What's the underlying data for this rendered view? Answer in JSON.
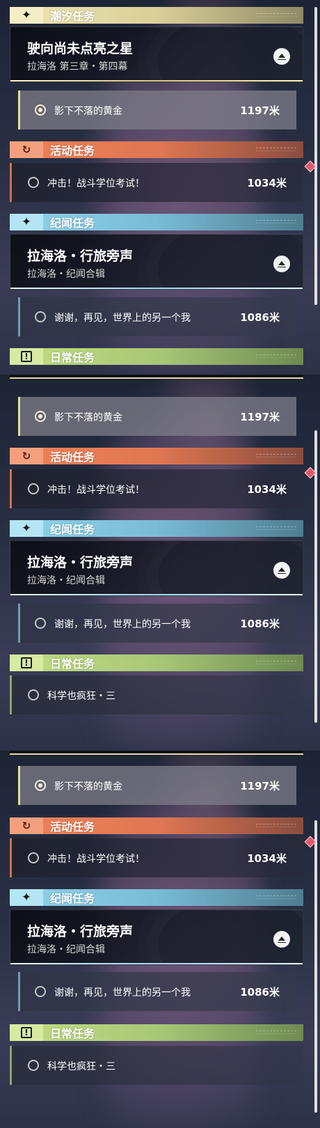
{
  "categories": {
    "trend": "潮汐任务",
    "event": "活动任务",
    "lore": "纪闻任务",
    "daily": "日常任务"
  },
  "main_quest": {
    "title": "驶向尚未点亮之星",
    "subtitle": "拉海洛 第三章・第四幕"
  },
  "tracked_quest": {
    "name": "影下不落的黄金",
    "distance": "1197米"
  },
  "event_quest": {
    "name": "冲击！战斗学位考试！",
    "distance": "1034米"
  },
  "lore_quest": {
    "title": "拉海洛・行旅旁声",
    "subtitle": "拉海洛・纪闻合辑"
  },
  "lore_sub": {
    "name": "谢谢，再见，世界上的另一个我",
    "distance": "1086米"
  },
  "daily_quest": {
    "name": "科学也疯狂・三"
  },
  "icons": {
    "trend": "four-point-star-icon",
    "event": "event-refresh-icon",
    "lore": "four-point-star-icon",
    "daily": "exclamation-box-icon"
  },
  "colors": {
    "trend": "#efe6b3",
    "event": "#f08158",
    "lore": "#8fd3ea",
    "daily": "#c2de82",
    "new_marker": "#e05a6e"
  }
}
